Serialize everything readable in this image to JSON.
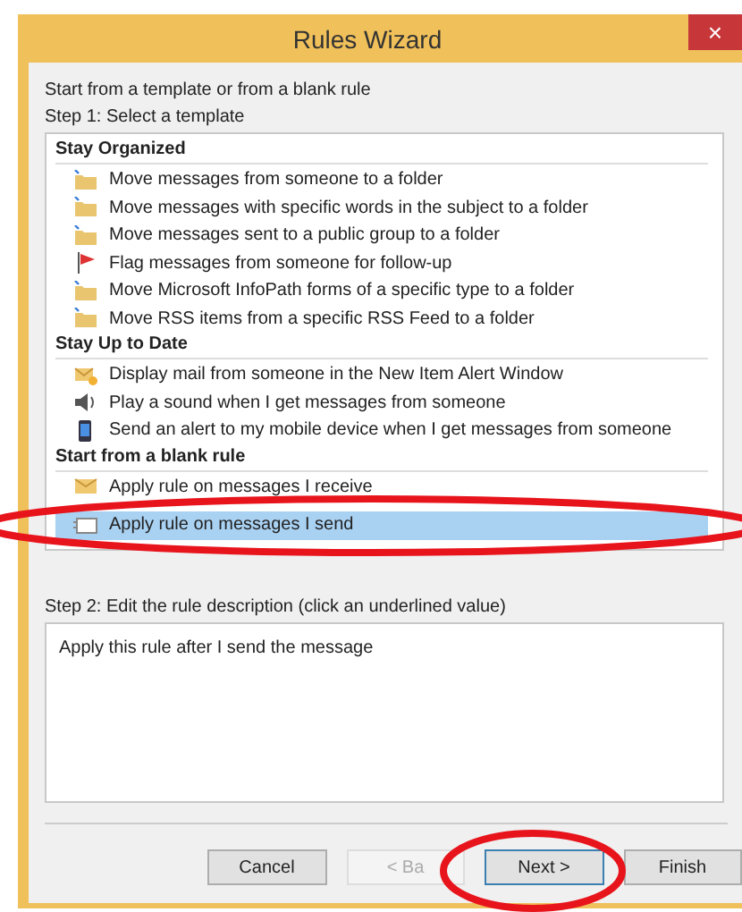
{
  "window": {
    "title": "Rules Wizard",
    "close": "×"
  },
  "intro": "Start from a template or from a blank rule",
  "step1": "Step 1: Select a template",
  "groups": [
    {
      "title": "Stay Organized",
      "items": [
        {
          "label": "Move messages from someone to a folder",
          "kind": "folder",
          "selected": false
        },
        {
          "label": "Move messages with specific words in the subject to a folder",
          "kind": "folder",
          "selected": false
        },
        {
          "label": "Move messages sent to a public group to a folder",
          "kind": "folder",
          "selected": false
        },
        {
          "label": "Flag messages from someone for follow-up",
          "kind": "flag",
          "selected": false
        },
        {
          "label": "Move Microsoft InfoPath forms of a specific type to a folder",
          "kind": "folder",
          "selected": false
        },
        {
          "label": "Move RSS items from a specific RSS Feed to a folder",
          "kind": "folder",
          "selected": false
        }
      ]
    },
    {
      "title": "Stay Up to Date",
      "items": [
        {
          "label": "Display mail from someone in the New Item Alert Window",
          "kind": "alert",
          "selected": false
        },
        {
          "label": "Play a sound when I get messages from someone",
          "kind": "sound",
          "selected": false
        },
        {
          "label": "Send an alert to my mobile device when I get messages from someone",
          "kind": "mobile",
          "selected": false
        }
      ]
    },
    {
      "title": "Start from a blank rule",
      "items": [
        {
          "label": "Apply rule on messages I receive",
          "kind": "receive",
          "selected": false
        },
        {
          "label": "Apply rule on messages I send",
          "kind": "send",
          "selected": true
        }
      ]
    }
  ],
  "step2": "Step 2: Edit the rule description (click an underlined value)",
  "description": "Apply this rule after I send the message",
  "buttons": [
    {
      "label": "Cancel",
      "disabled": false,
      "focused": false
    },
    {
      "label": "< Ba",
      "disabled": true,
      "focused": false
    },
    {
      "label": "Next >",
      "disabled": false,
      "focused": true
    },
    {
      "label": "Finish",
      "disabled": false,
      "focused": false
    }
  ]
}
